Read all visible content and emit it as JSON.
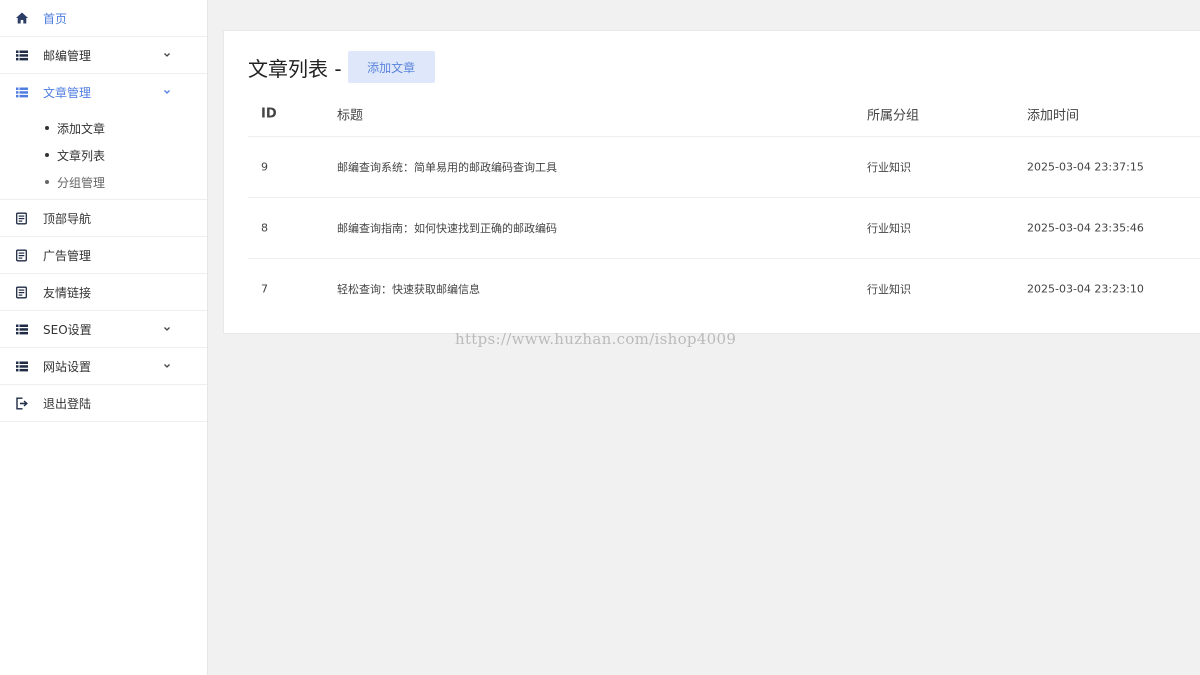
{
  "sidebar": {
    "items": [
      {
        "label": "首页",
        "icon": "home-icon",
        "active": true
      },
      {
        "label": "邮编管理",
        "icon": "list-icon",
        "expandable": true
      },
      {
        "label": "文章管理",
        "icon": "list-icon",
        "expandable": true,
        "expanded": true,
        "children": [
          {
            "label": "添加文章"
          },
          {
            "label": "文章列表"
          },
          {
            "label": "分组管理"
          }
        ]
      },
      {
        "label": "顶部导航",
        "icon": "document-icon"
      },
      {
        "label": "广告管理",
        "icon": "document-icon"
      },
      {
        "label": "友情链接",
        "icon": "document-icon"
      },
      {
        "label": "SEO设置",
        "icon": "list-icon",
        "expandable": true
      },
      {
        "label": "网站设置",
        "icon": "list-icon",
        "expandable": true
      },
      {
        "label": "退出登陆",
        "icon": "logout-icon"
      }
    ]
  },
  "main": {
    "title": "文章列表 -",
    "add_button": "添加文章",
    "table": {
      "headers": [
        "ID",
        "标题",
        "所属分组",
        "添加时间"
      ],
      "rows": [
        {
          "id": "9",
          "title": "邮编查询系统：简单易用的邮政编码查询工具",
          "group": "行业知识",
          "time": "2025-03-04 23:37:15"
        },
        {
          "id": "8",
          "title": "邮编查询指南：如何快速找到正确的邮政编码",
          "group": "行业知识",
          "time": "2025-03-04 23:35:46"
        },
        {
          "id": "7",
          "title": "轻松查询：快速获取邮编信息",
          "group": "行业知识",
          "time": "2025-03-04 23:23:10"
        }
      ]
    }
  },
  "watermark": "https://www.huzhan.com/ishop4009",
  "colors": {
    "accent": "#4f7de0",
    "button_bg": "#dfe8fb",
    "icon_dark": "#1f2a44"
  }
}
